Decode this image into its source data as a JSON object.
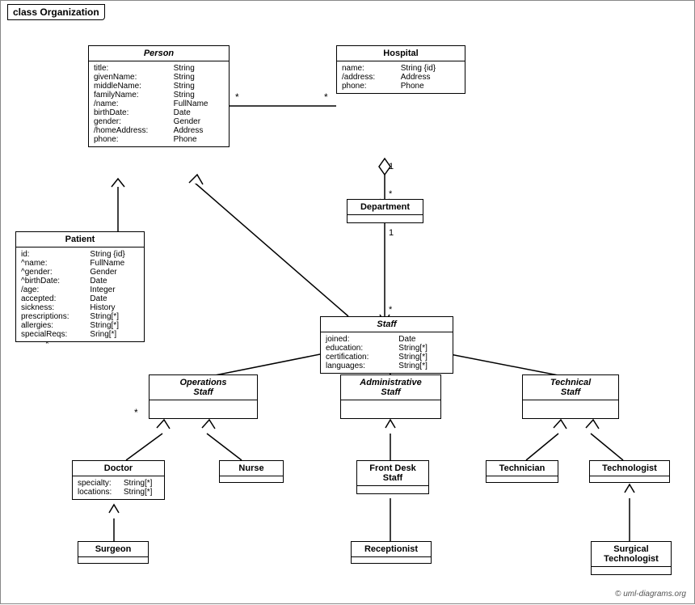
{
  "diagram": {
    "title": "class Organization",
    "copyright": "© uml-diagrams.org",
    "boxes": {
      "person": {
        "title": "Person",
        "attrs": [
          [
            "title:",
            "String"
          ],
          [
            "givenName:",
            "String"
          ],
          [
            "middleName:",
            "String"
          ],
          [
            "familyName:",
            "String"
          ],
          [
            "/name:",
            "FullName"
          ],
          [
            "birthDate:",
            "Date"
          ],
          [
            "gender:",
            "Gender"
          ],
          [
            "/homeAddress:",
            "Address"
          ],
          [
            "phone:",
            "Phone"
          ]
        ]
      },
      "hospital": {
        "title": "Hospital",
        "attrs": [
          [
            "name:",
            "String {id}"
          ],
          [
            "/address:",
            "Address"
          ],
          [
            "phone:",
            "Phone"
          ]
        ]
      },
      "department": {
        "title": "Department",
        "attrs": []
      },
      "patient": {
        "title": "Patient",
        "attrs": [
          [
            "id:",
            "String {id}"
          ],
          [
            "^name:",
            "FullName"
          ],
          [
            "^gender:",
            "Gender"
          ],
          [
            "^birthDate:",
            "Date"
          ],
          [
            "/age:",
            "Integer"
          ],
          [
            "accepted:",
            "Date"
          ],
          [
            "sickness:",
            "History"
          ],
          [
            "prescriptions:",
            "String[*]"
          ],
          [
            "allergies:",
            "String[*]"
          ],
          [
            "specialReqs:",
            "Sring[*]"
          ]
        ]
      },
      "staff": {
        "title": "Staff",
        "attrs": [
          [
            "joined:",
            "Date"
          ],
          [
            "education:",
            "String[*]"
          ],
          [
            "certification:",
            "String[*]"
          ],
          [
            "languages:",
            "String[*]"
          ]
        ]
      },
      "operations_staff": {
        "title": "Operations\nStaff",
        "italic": true
      },
      "administrative_staff": {
        "title": "Administrative\nStaff",
        "italic": true
      },
      "technical_staff": {
        "title": "Technical\nStaff",
        "italic": true
      },
      "doctor": {
        "title": "Doctor",
        "attrs": [
          [
            "specialty:",
            "String[*]"
          ],
          [
            "locations:",
            "String[*]"
          ]
        ]
      },
      "nurse": {
        "title": "Nurse",
        "attrs": []
      },
      "front_desk_staff": {
        "title": "Front Desk\nStaff",
        "attrs": []
      },
      "technician": {
        "title": "Technician",
        "attrs": []
      },
      "technologist": {
        "title": "Technologist",
        "attrs": []
      },
      "surgeon": {
        "title": "Surgeon",
        "attrs": []
      },
      "receptionist": {
        "title": "Receptionist",
        "attrs": []
      },
      "surgical_technologist": {
        "title": "Surgical\nTechnologist",
        "attrs": []
      }
    }
  }
}
